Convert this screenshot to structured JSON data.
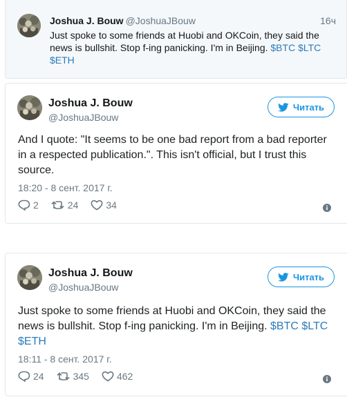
{
  "quoted_tweet": {
    "name": "Joshua J. Bouw",
    "handle": "@JoshuaJBouw",
    "time": "16ч",
    "text_plain": "Just spoke to some friends at Huobi and OKCoin, they said the news is bullshit. Stop f-ing panicking. I'm in Beijing.",
    "hashtags": [
      "$BTC",
      "$LTC",
      "$ETH"
    ]
  },
  "tweets": [
    {
      "name": "Joshua J. Bouw",
      "handle": "@JoshuaJBouw",
      "follow_label": "Читать",
      "text": "And I quote: \"It seems to be one bad report from a bad reporter in a respected publication.\". This isn't official, but I trust this source.",
      "time": "18:20 - 8 сент. 2017 г.",
      "replies": "2",
      "retweets": "24",
      "likes": "34"
    },
    {
      "name": "Joshua J. Bouw",
      "handle": "@JoshuaJBouw",
      "follow_label": "Читать",
      "text_plain": "Just spoke to some friends at Huobi and OKCoin, they said the news is bullshit. Stop f-ing panicking. I'm in Beijing.",
      "hashtags": [
        "$BTC",
        "$LTC",
        "$ETH"
      ],
      "time": "18:11 - 8 сент. 2017 г.",
      "replies": "24",
      "retweets": "345",
      "likes": "462"
    }
  ],
  "colors": {
    "accent": "#1b95e0",
    "link": "#2b7bb9",
    "muted": "#697882",
    "quoted_bg": "#f5f8fa",
    "border": "#e1e8ed"
  },
  "icons": [
    "twitter-bird-icon",
    "reply-icon",
    "retweet-icon",
    "like-icon",
    "info-icon"
  ]
}
